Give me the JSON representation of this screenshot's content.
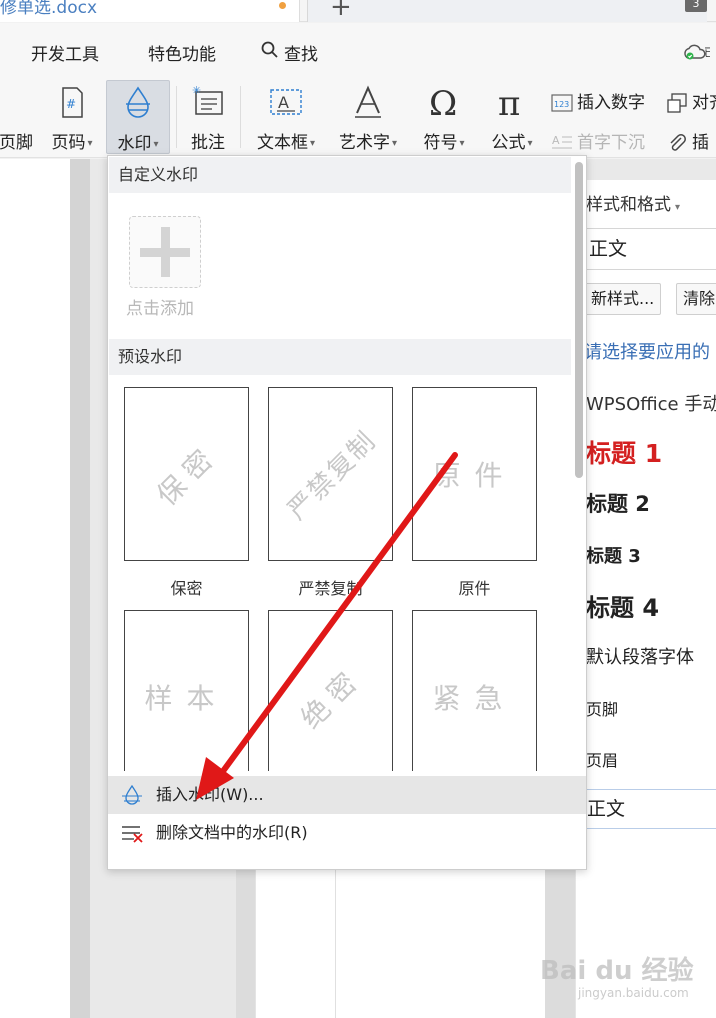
{
  "tabbar": {
    "doc_title": "修单选.docx",
    "new_tab": "+",
    "tab_count": "3"
  },
  "menu": {
    "items": [
      "开发工具",
      "特色功能"
    ],
    "search_label": "查找"
  },
  "ribbon": {
    "footer_label": "页脚",
    "page_number_label": "页码",
    "watermark_label": "水印",
    "comment_label": "批注",
    "textbox_label": "文本框",
    "wordart_label": "艺术字",
    "symbol_label": "符号",
    "formula_label": "公式",
    "insert_number_label": "插入数字",
    "align_label": "对齐",
    "drop_cap_label": "首字下沉",
    "attachment_label": "插"
  },
  "dropdown": {
    "custom_section": "自定义水印",
    "add_label": "点击添加",
    "preset_section": "预设水印",
    "presets": [
      {
        "text": "保密",
        "caption": "保密"
      },
      {
        "text": "严禁复制",
        "caption": "严禁复制"
      },
      {
        "text": "原件",
        "caption": "原件"
      },
      {
        "text": "样本",
        "caption": ""
      },
      {
        "text": "绝密",
        "caption": ""
      },
      {
        "text": "紧急",
        "caption": ""
      }
    ],
    "insert_action": "插入水印(W)...",
    "delete_action": "删除文档中的水印(R)"
  },
  "styles_pane": {
    "title": "样式和格式",
    "current_style": "正文",
    "new_style_button": "新样式...",
    "clear_button": "清除",
    "hint": "请选择要应用的",
    "entries": [
      {
        "label": "WPSOffice 手动"
      },
      {
        "label": "标题 1"
      },
      {
        "label": "标题 2"
      },
      {
        "label": "标题 3"
      },
      {
        "label": "标题 4"
      },
      {
        "label": "默认段落字体"
      },
      {
        "label": "页脚"
      },
      {
        "label": "页眉"
      },
      {
        "label": "正文"
      }
    ]
  },
  "branding": {
    "logo_text": "Bai du 经验",
    "url": "jingyan.baidu.com"
  },
  "colors": {
    "accent_blue": "#3a6fb5",
    "heading1_red": "#d42020",
    "arrow_red": "#e01818"
  }
}
